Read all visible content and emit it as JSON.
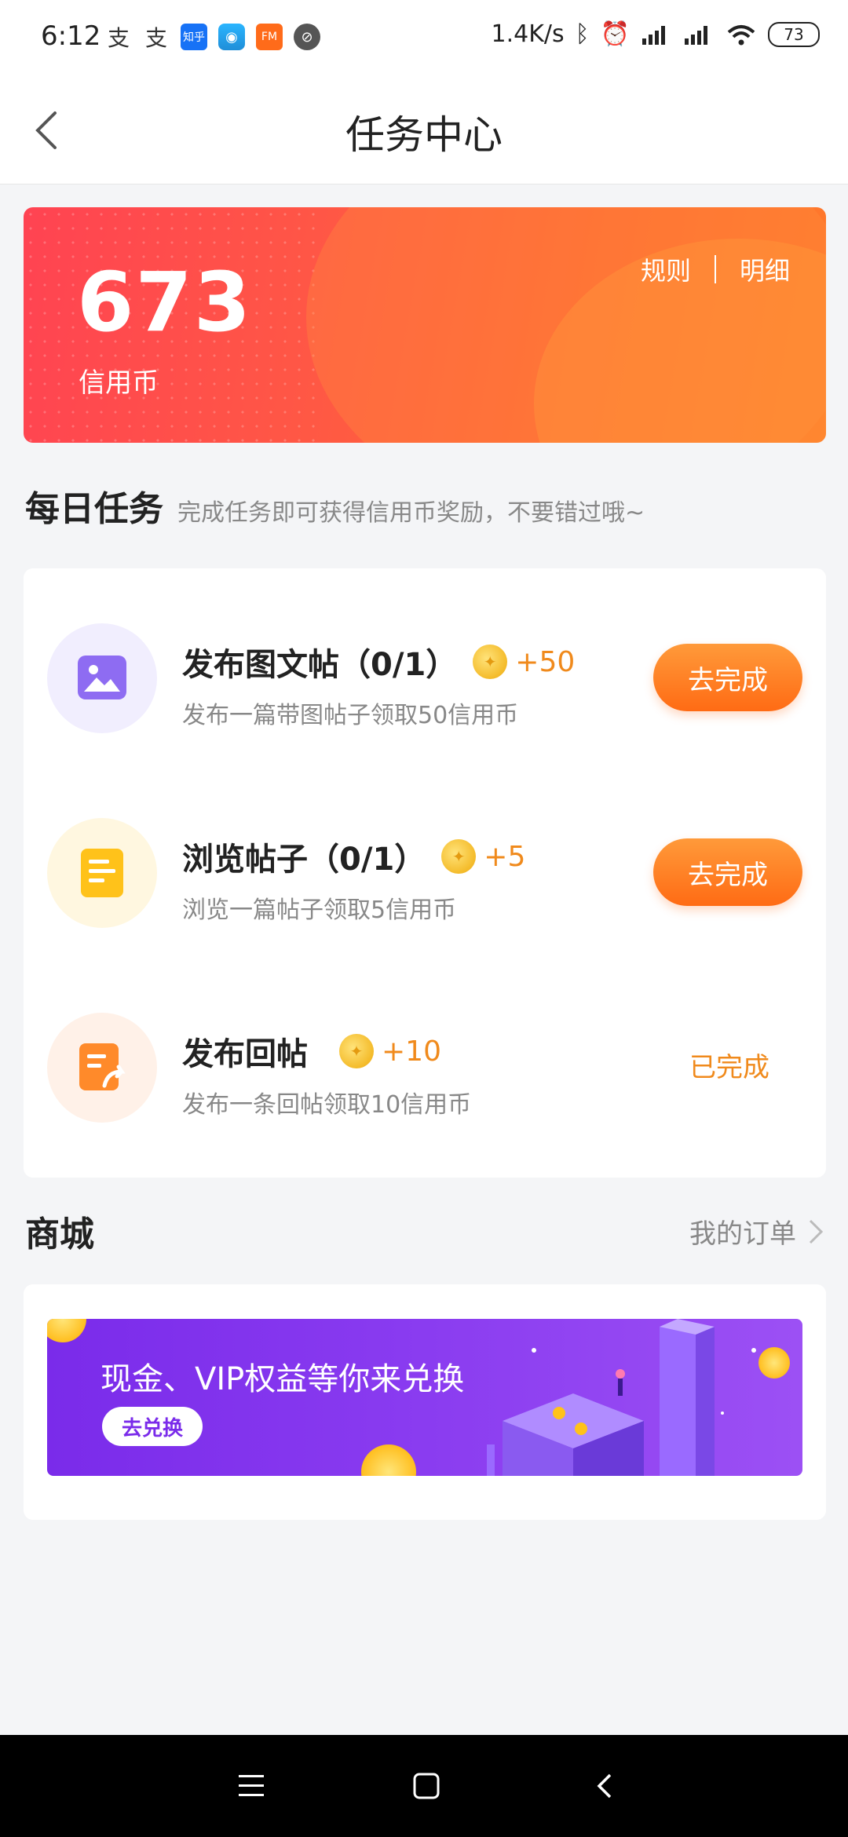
{
  "status_bar": {
    "time": "6:12",
    "network_speed": "1.4K/s",
    "battery": "73",
    "left_icons": [
      "alipay-icon",
      "alipay-icon",
      "zhihu-icon",
      "mobile-app-icon",
      "fm-app-icon",
      "no-disturb-icon"
    ],
    "zhihu_label": "知乎",
    "fm_label": "FM"
  },
  "navbar": {
    "title": "任务中心"
  },
  "balance": {
    "amount": "673",
    "unit": "信用币",
    "rules_link": "规则",
    "detail_link": "明细"
  },
  "daily": {
    "title": "每日任务",
    "subtitle": "完成任务即可获得信用币奖励，不要错过哦~",
    "tasks": [
      {
        "title": "发布图文帖（0/1）",
        "reward": "+50",
        "desc": "发布一篇带图帖子领取50信用币",
        "action": "去完成",
        "icon": "image-post-icon",
        "color": "#8e6cf2"
      },
      {
        "title": "浏览帖子（0/1）",
        "reward": "+5",
        "desc": "浏览一篇帖子领取5信用币",
        "action": "去完成",
        "icon": "browse-post-icon",
        "color": "#ffc21a"
      },
      {
        "title": "发布回帖",
        "reward": "+10",
        "desc": "发布一条回帖领取10信用币",
        "action": "已完成",
        "icon": "reply-post-icon",
        "color": "#ff8a2a"
      }
    ]
  },
  "mall": {
    "title": "商城",
    "orders_link": "我的订单",
    "banner_text": "现金、VIP权益等你来兑换",
    "banner_button": "去兑换"
  },
  "colors": {
    "accent": "#ff6b14",
    "reward": "#f08a1c",
    "banner": "#7a2bea"
  }
}
